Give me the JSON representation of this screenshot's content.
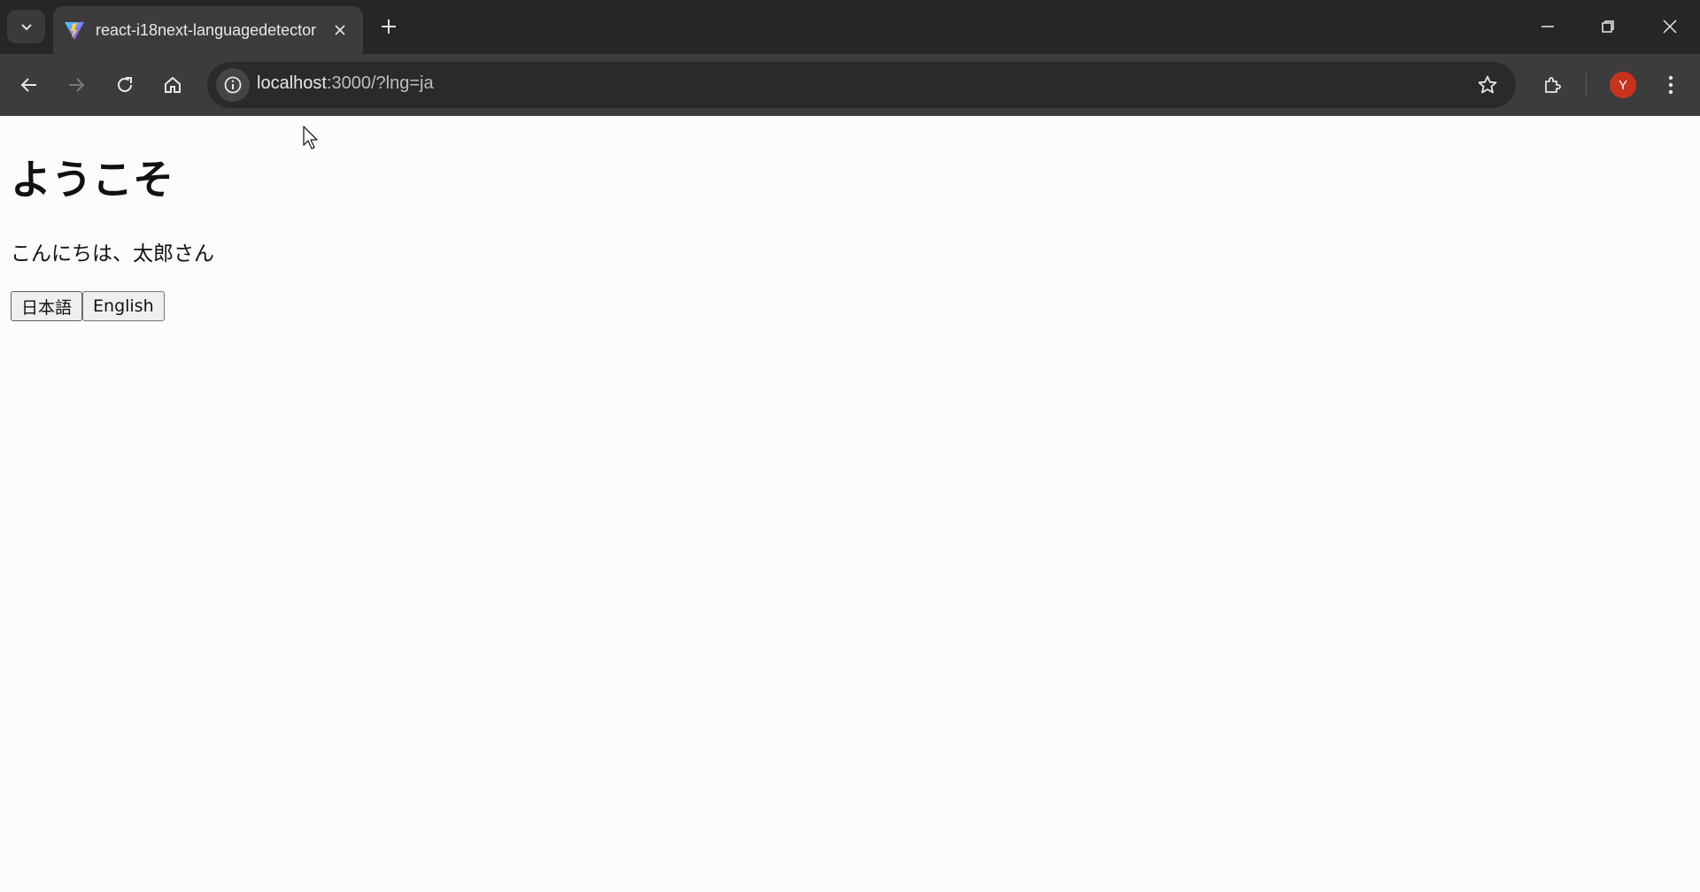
{
  "browser": {
    "tab": {
      "title": "react-i18next-languagedetector"
    },
    "url": {
      "host": "localhost",
      "path": ":3000/?lng=ja"
    },
    "profile_initial": "Y",
    "profile_color": "#c7341b",
    "icons": [
      "tab-search-icon",
      "vite-logo-icon",
      "close-icon",
      "plus-icon",
      "minimize-icon",
      "restore-icon",
      "window-close-icon",
      "back-arrow-icon",
      "forward-arrow-icon",
      "reload-icon",
      "home-icon",
      "info-icon",
      "star-icon",
      "extensions-icon",
      "kebab-menu-icon"
    ]
  },
  "page": {
    "heading": "ようこそ",
    "greeting": "こんにちは、太郎さん",
    "buttons": {
      "japanese": "日本語",
      "english": "English"
    }
  }
}
